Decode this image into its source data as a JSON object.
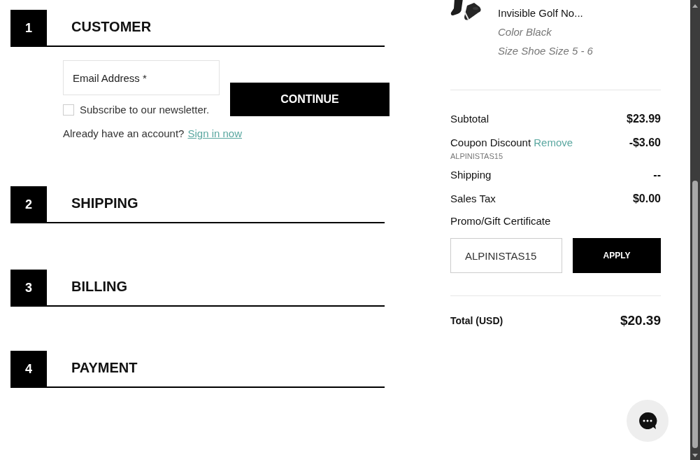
{
  "steps": [
    {
      "number": "1",
      "title": "CUSTOMER"
    },
    {
      "number": "2",
      "title": "SHIPPING"
    },
    {
      "number": "3",
      "title": "BILLING"
    },
    {
      "number": "4",
      "title": "PAYMENT"
    }
  ],
  "customer": {
    "email": {
      "placeholder": "Email Address *"
    },
    "continue": "CONTINUE",
    "newsletter": {
      "label": "Subscribe to our newsletter.",
      "checked": false
    },
    "account_prompt": "Already have an account?",
    "sign_in": "Sign in now"
  },
  "summary": {
    "item": {
      "name": "Invisible Golf No...",
      "options": [
        "Color Black",
        "Size Shoe Size 5 - 6"
      ]
    },
    "lines": [
      {
        "label": "Subtotal",
        "value": "$23.99"
      },
      {
        "label": "Coupon Discount",
        "action": "Remove",
        "value": "-$3.60",
        "code": "ALPINISTAS15"
      },
      {
        "label": "Shipping",
        "value": "--"
      },
      {
        "label": "Sales Tax",
        "value": "$0.00"
      }
    ],
    "promo": {
      "label": "Promo/Gift Certificate",
      "value": "ALPINISTAS15",
      "button": "APPLY"
    },
    "total": {
      "label": "Total (USD)",
      "value": "$20.39"
    }
  }
}
